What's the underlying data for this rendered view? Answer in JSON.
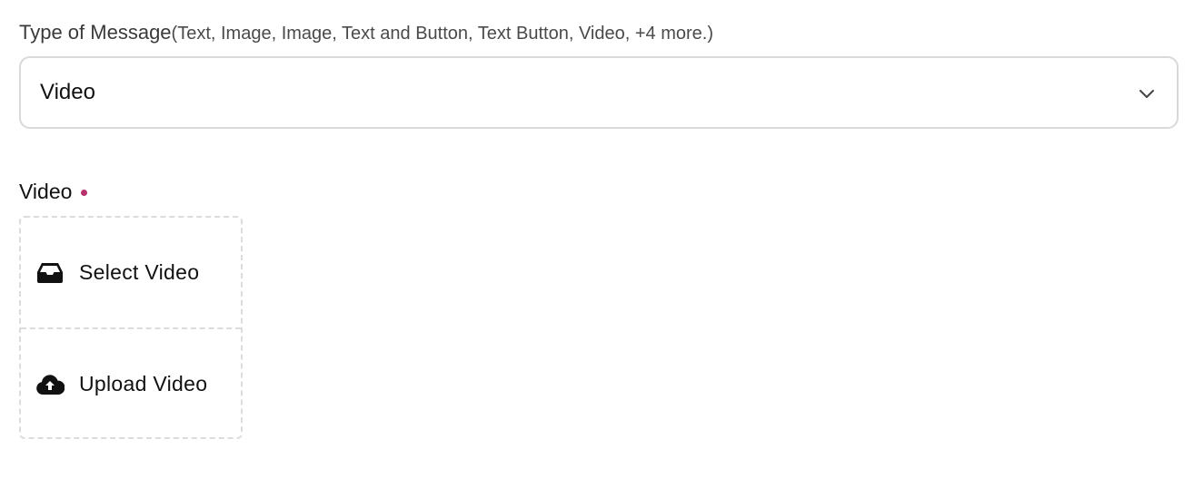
{
  "message_type": {
    "label": "Type of Message",
    "hint": "(Text, Image, Image, Text and Button, Text Button, Video, +4 more.)",
    "selected_value": "Video",
    "dropdown_icon": "chevron-down-icon"
  },
  "video_field": {
    "label": "Video",
    "required": true,
    "required_color": "#b5316a",
    "options": [
      {
        "label": "Select Video",
        "icon": "inbox-tray-icon"
      },
      {
        "label": "Upload Video",
        "icon": "cloud-upload-icon"
      }
    ]
  }
}
